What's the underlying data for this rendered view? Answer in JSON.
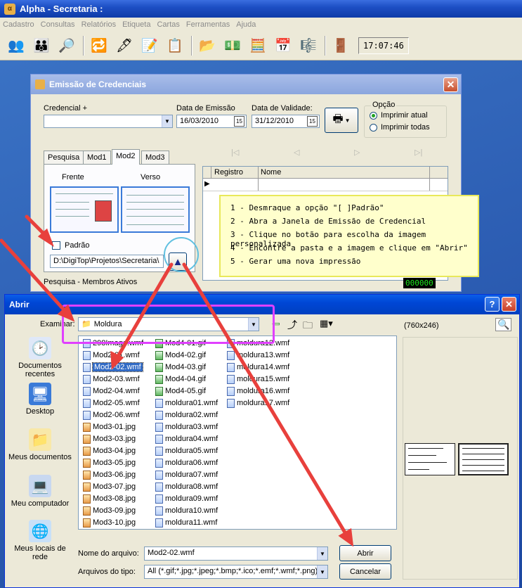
{
  "app": {
    "title": "Alpha - Secretaria :",
    "clock": "17:07:46"
  },
  "menu": [
    "Cadastro",
    "Consultas",
    "Relatórios",
    "Etiqueta",
    "Cartas",
    "Ferramentas",
    "Ajuda"
  ],
  "credentials_dialog": {
    "title": "Emissão de Credenciais",
    "credencial_label": "Credencial +",
    "credencial_value": "",
    "data_emissao_label": "Data de Emissão",
    "data_emissao_value": "16/03/2010",
    "data_validade_label": "Data de Validade:",
    "data_validade_value": "31/12/2010",
    "calendar_badge": "15",
    "opcao_label": "Opção",
    "opcao_options": [
      "Imprimir atual",
      "Imprimir todas"
    ],
    "opcao_selected": "Imprimir atual",
    "tabs": [
      "Pesquisa",
      "Mod1",
      "Mod2",
      "Mod3"
    ],
    "active_tab": "Mod2",
    "frente_label": "Frente",
    "verso_label": "Verso",
    "padrao_label": "Padrão",
    "padrao_checked": false,
    "path_value": "D:\\DigiTop\\Projetos\\Secretaria\\",
    "grid_columns": [
      "Registro",
      "Nome"
    ],
    "status_text": "Pesquisa - Membros Ativos",
    "counter": "000000"
  },
  "instructions": [
    "1 - Desmraque a opção \"[ ]Padrão\"",
    "2 - Abra a Janela de Emissão de Credencial",
    "3 - Clique no botão para escolha da imagem personalizada",
    "4 - Encontre a pasta e a imagem e clique em \"Abrir\"",
    "5 - Gerar uma nova impressão"
  ],
  "open_dialog": {
    "title": "Abrir",
    "examinar_label": "Examinar:",
    "folder": "Moldura",
    "preview_size": "(760x246)",
    "places": [
      "Documentos recentes",
      "Desktop",
      "Meus documentos",
      "Meu computador",
      "Meus locais de rede"
    ],
    "columns": [
      [
        {
          "name": "298Image.wmf",
          "type": "wmf"
        },
        {
          "name": "Mod2-01.wmf",
          "type": "wmf"
        },
        {
          "name": "Mod2-02.wmf",
          "type": "wmf"
        },
        {
          "name": "Mod2-03.wmf",
          "type": "wmf"
        },
        {
          "name": "Mod2-04.wmf",
          "type": "wmf"
        },
        {
          "name": "Mod2-05.wmf",
          "type": "wmf"
        },
        {
          "name": "Mod2-06.wmf",
          "type": "wmf"
        },
        {
          "name": "Mod3-01.jpg",
          "type": "jpg"
        },
        {
          "name": "Mod3-03.jpg",
          "type": "jpg"
        },
        {
          "name": "Mod3-04.jpg",
          "type": "jpg"
        },
        {
          "name": "Mod3-05.jpg",
          "type": "jpg"
        },
        {
          "name": "Mod3-06.jpg",
          "type": "jpg"
        },
        {
          "name": "Mod3-07.jpg",
          "type": "jpg"
        },
        {
          "name": "Mod3-08.jpg",
          "type": "jpg"
        },
        {
          "name": "Mod3-09.jpg",
          "type": "jpg"
        },
        {
          "name": "Mod3-10.jpg",
          "type": "jpg"
        }
      ],
      [
        {
          "name": "Mod4-01.gif",
          "type": "gif"
        },
        {
          "name": "Mod4-02.gif",
          "type": "gif"
        },
        {
          "name": "Mod4-03.gif",
          "type": "gif"
        },
        {
          "name": "Mod4-04.gif",
          "type": "gif"
        },
        {
          "name": "Mod4-05.gif",
          "type": "gif"
        },
        {
          "name": "moldura01.wmf",
          "type": "wmf"
        },
        {
          "name": "moldura02.wmf",
          "type": "wmf"
        },
        {
          "name": "moldura03.wmf",
          "type": "wmf"
        },
        {
          "name": "moldura04.wmf",
          "type": "wmf"
        },
        {
          "name": "moldura05.wmf",
          "type": "wmf"
        },
        {
          "name": "moldura06.wmf",
          "type": "wmf"
        },
        {
          "name": "moldura07.wmf",
          "type": "wmf"
        },
        {
          "name": "moldura08.wmf",
          "type": "wmf"
        },
        {
          "name": "moldura09.wmf",
          "type": "wmf"
        },
        {
          "name": "moldura10.wmf",
          "type": "wmf"
        },
        {
          "name": "moldura11.wmf",
          "type": "wmf"
        }
      ],
      [
        {
          "name": "moldura12.wmf",
          "type": "wmf"
        },
        {
          "name": "moldura13.wmf",
          "type": "wmf"
        },
        {
          "name": "moldura14.wmf",
          "type": "wmf"
        },
        {
          "name": "moldura15.wmf",
          "type": "wmf"
        },
        {
          "name": "moldura16.wmf",
          "type": "wmf"
        },
        {
          "name": "moldura17.wmf",
          "type": "wmf"
        }
      ]
    ],
    "selected_file": "Mod2-02.wmf",
    "filename_label": "Nome do arquivo:",
    "filename_value": "Mod2-02.wmf",
    "filetype_label": "Arquivos do tipo:",
    "filetype_value": "All (*.gif;*.jpg;*.jpeg;*.bmp;*.ico;*.emf;*.wmf;*.png)",
    "open_button": "Abrir",
    "cancel_button": "Cancelar"
  },
  "colors": {
    "annotation_arrow": "#e8403c",
    "highlight_box": "#e040ff",
    "note_bg": "#ffffcc"
  }
}
